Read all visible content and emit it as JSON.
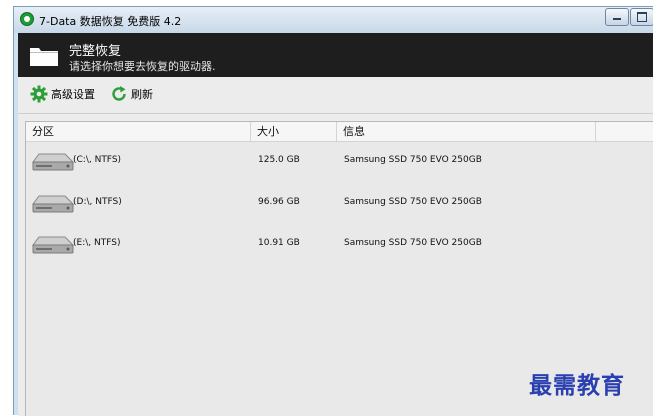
{
  "window": {
    "title": "7-Data 数据恢复 免费版 4.2"
  },
  "header": {
    "title": "完整恢复",
    "subtitle": "请选择你想要去恢复的驱动器."
  },
  "toolbar": {
    "advanced_label": "高级设置",
    "refresh_label": "刷新"
  },
  "table": {
    "columns": [
      "分区",
      "大小",
      "信息"
    ],
    "rows": [
      {
        "partition": "(C:\\, NTFS)",
        "size": "125.0 GB",
        "info": "Samsung SSD 750 EVO 250GB"
      },
      {
        "partition": "(D:\\, NTFS)",
        "size": "96.96 GB",
        "info": "Samsung SSD 750 EVO 250GB"
      },
      {
        "partition": "(E:\\, NTFS)",
        "size": "10.91 GB",
        "info": "Samsung SSD 750 EVO 250GB"
      }
    ]
  },
  "watermark": "最需教育",
  "icons": {
    "app": "app-logo-icon",
    "folder": "folder-icon",
    "advanced": "gear-icon",
    "refresh": "refresh-icon",
    "drive": "hard-drive-icon"
  },
  "colors": {
    "accent_green": "#2e9e3a",
    "header_dark": "#1e1e1e",
    "watermark_blue": "#2a3fb0"
  }
}
